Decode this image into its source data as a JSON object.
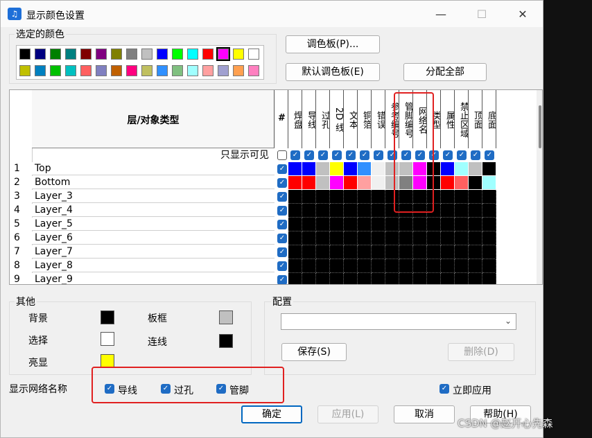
{
  "window": {
    "title": "显示颜色设置"
  },
  "selected_colors": {
    "label": "选定的颜色",
    "row1": [
      "#000000",
      "#000080",
      "#008000",
      "#008080",
      "#800000",
      "#800080",
      "#808000",
      "#808080",
      "#c0c0c0",
      "#0000ff",
      "#00ff00",
      "#00ffff",
      "#ff0000",
      "#ff00ff",
      "#ffff00",
      "#ffffff"
    ],
    "row2": [
      "#c0c000",
      "#0080c0",
      "#00c000",
      "#00c0c0",
      "#ff6060",
      "#8080c0",
      "#c06000",
      "#ff0080",
      "#c0c060",
      "#3090ff",
      "#80c080",
      "#a0ffff",
      "#ffa0a0",
      "#a0a0d0",
      "#ffa050",
      "#ff80c0"
    ],
    "selected_index": 13
  },
  "buttons": {
    "palette": "调色板(P)...",
    "default_palette": "默认调色板(E)",
    "assign_all": "分配全部",
    "save": "保存(S)",
    "delete": "删除(D)",
    "ok": "确定",
    "apply": "应用(L)",
    "cancel": "取消",
    "help": "帮助(H)"
  },
  "grid": {
    "header_title": "层/对象类型",
    "hash": "#",
    "visible_only": "只显示可见",
    "columns": [
      "焊盘",
      "导线",
      "过孔",
      "2D 线",
      "文本",
      "铜箔",
      "错误",
      "参考编号",
      "管脚编号",
      "网络名",
      "类型",
      "属性",
      "禁止区域",
      "顶面",
      "底面"
    ],
    "rows": [
      {
        "num": "1",
        "name": "Top",
        "colors": [
          "#0000ff",
          "#0000ff",
          "#c0c0c0",
          "#ffff00",
          "#0000ff",
          "#3090ff",
          "#f0f0f0",
          "#c0c0c0",
          "#c0c0c0",
          "#ff00ff",
          "#000000",
          "#0000ff",
          "#a0ffff",
          "#c0c0c0",
          "#000000"
        ]
      },
      {
        "num": "2",
        "name": "Bottom",
        "colors": [
          "#ff0000",
          "#ff0000",
          "#c0c0c0",
          "#ff00ff",
          "#ff0000",
          "#ffa0a0",
          "#f0f0f0",
          "#c0c0c0",
          "#808080",
          "#ff00ff",
          "#000000",
          "#ff0000",
          "#ff6060",
          "#000000",
          "#a0ffff"
        ]
      },
      {
        "num": "3",
        "name": "Layer_3"
      },
      {
        "num": "4",
        "name": "Layer_4"
      },
      {
        "num": "5",
        "name": "Layer_5"
      },
      {
        "num": "6",
        "name": "Layer_6"
      },
      {
        "num": "7",
        "name": "Layer_7"
      },
      {
        "num": "8",
        "name": "Layer_8"
      },
      {
        "num": "9",
        "name": "Layer_9"
      }
    ]
  },
  "other": {
    "label": "其他",
    "background": {
      "label": "背景",
      "color": "#000000"
    },
    "board_frame": {
      "label": "板框",
      "color": "#c0c0c0"
    },
    "selection": {
      "label": "选择",
      "color": "#ffffff"
    },
    "connection": {
      "label": "连线",
      "color": "#000000"
    },
    "highlight": {
      "label": "亮显",
      "color": "#ffff00"
    }
  },
  "config": {
    "label": "配置",
    "value": ""
  },
  "net_names": {
    "label": "显示网络名称",
    "trace": "导线",
    "via": "过孔",
    "pin": "管脚"
  },
  "apply_now": "立即应用",
  "watermark": "CSDN @赵开心先森"
}
